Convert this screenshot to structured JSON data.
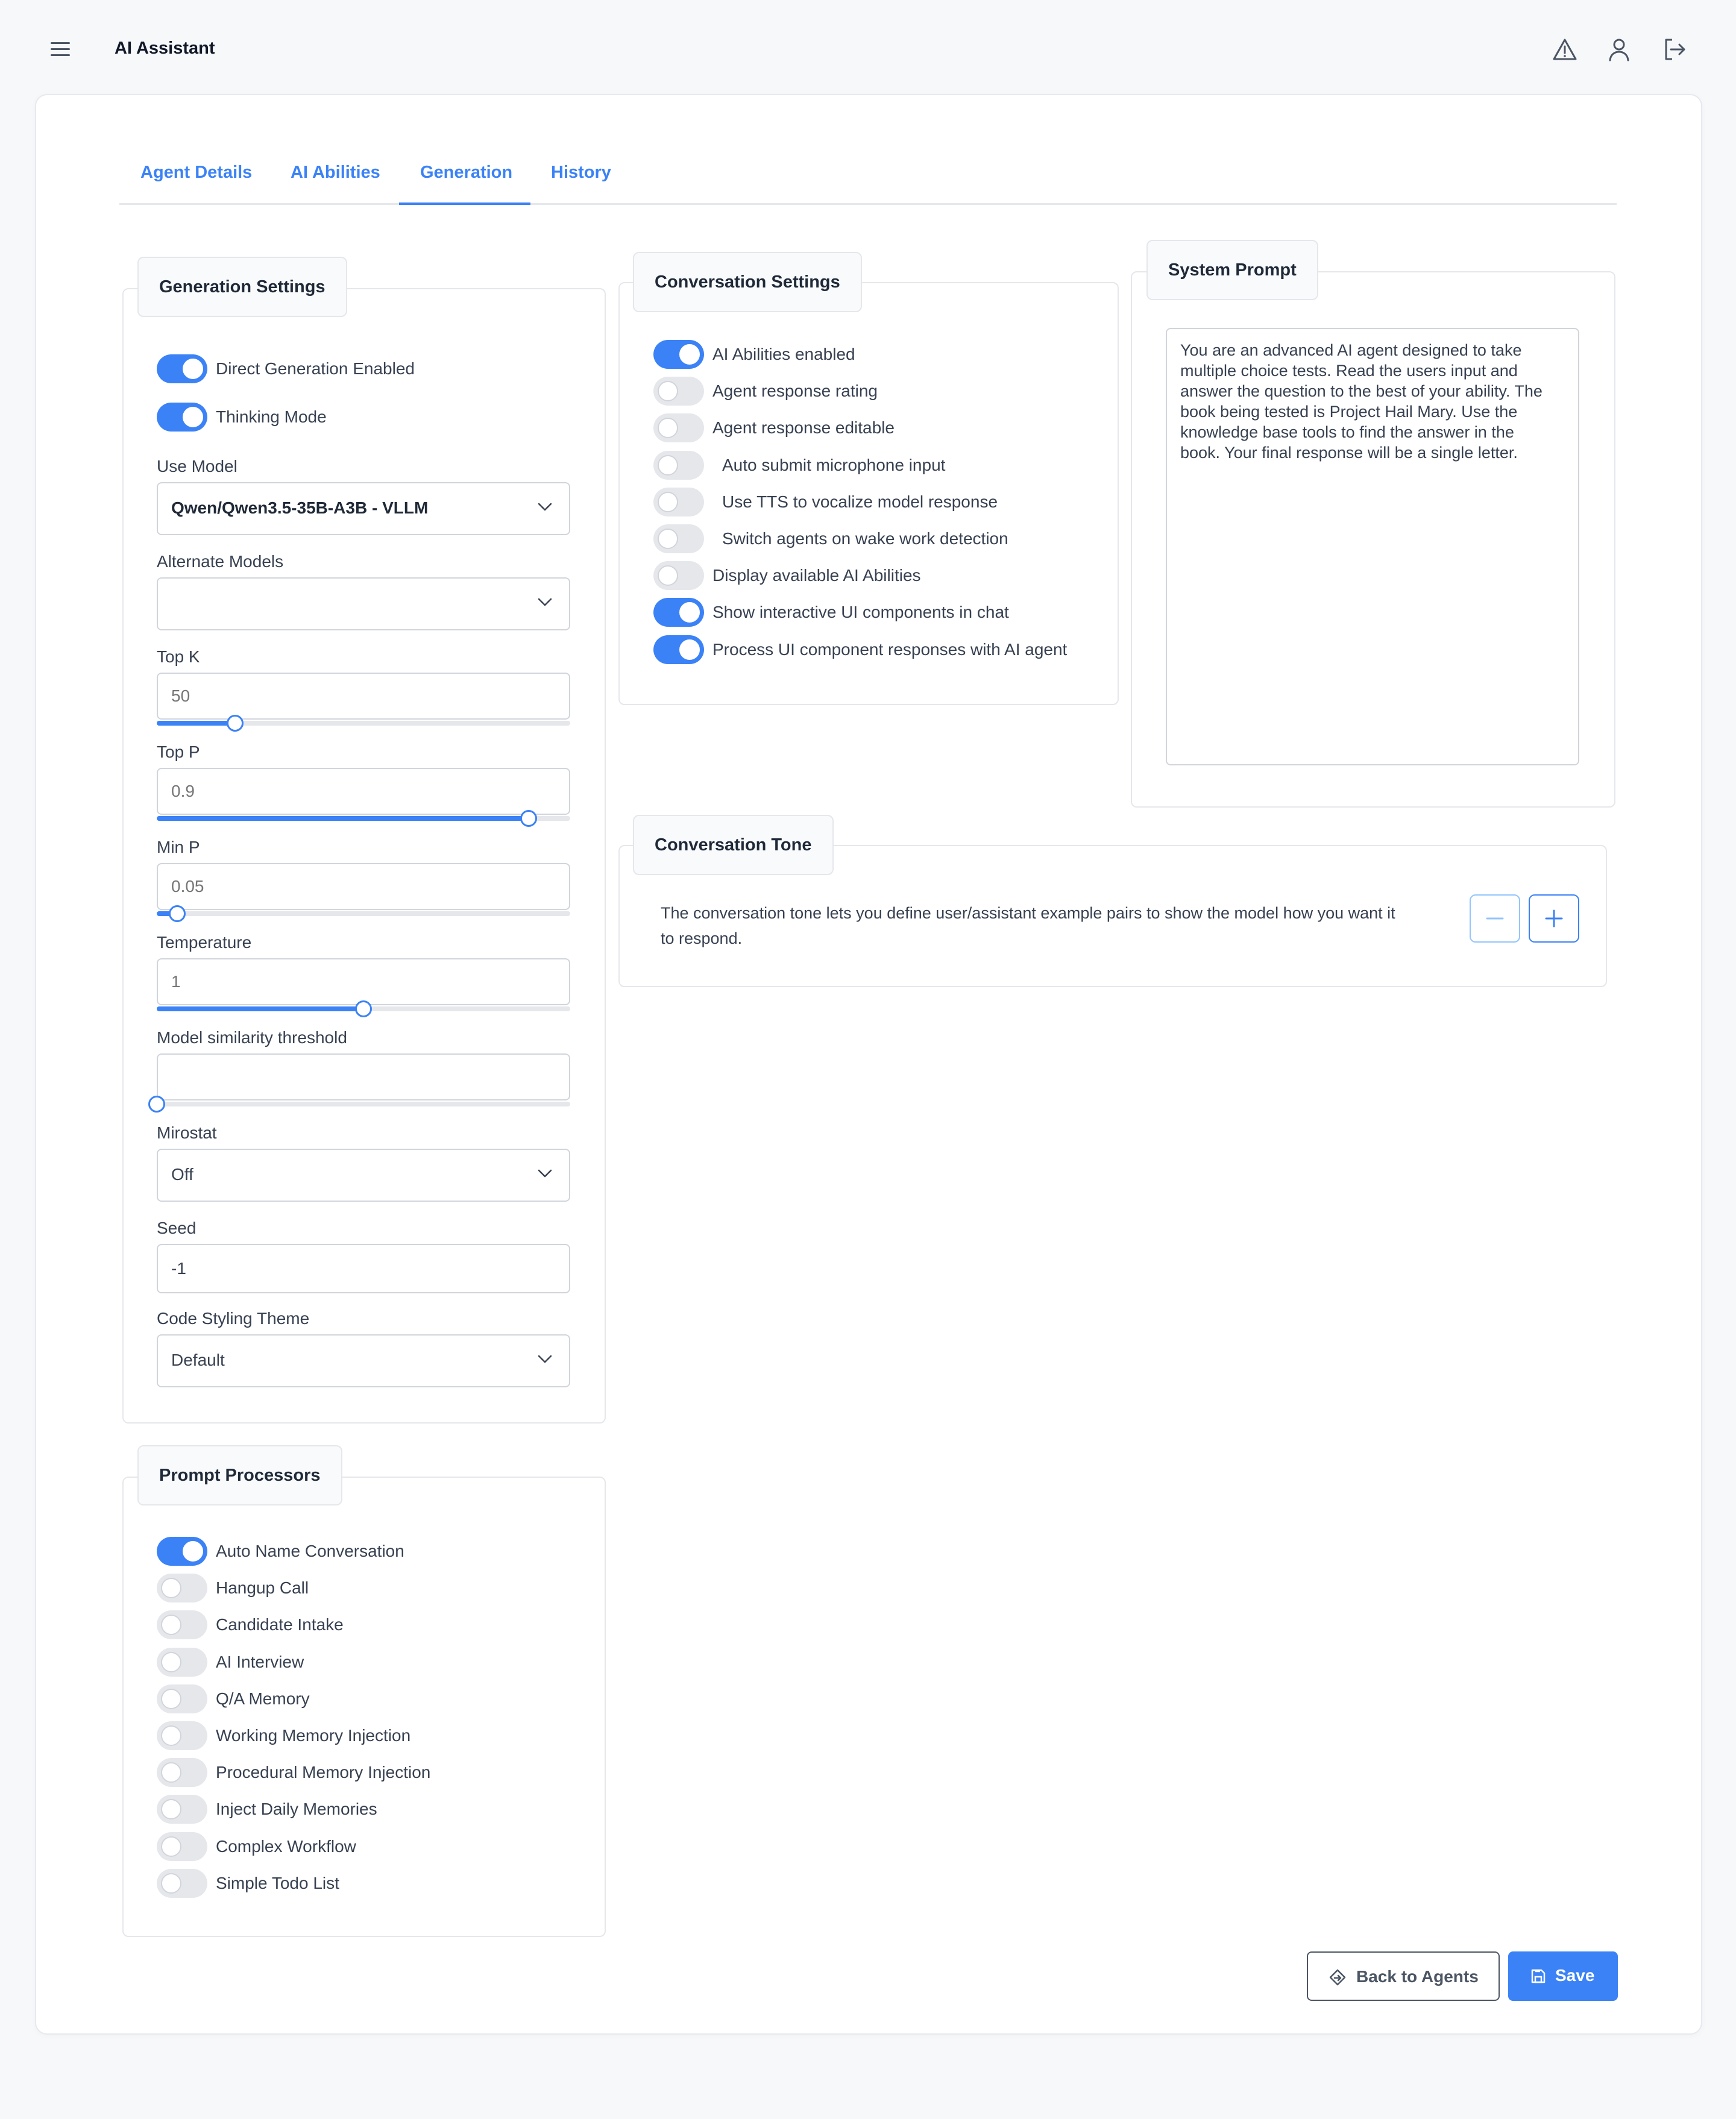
{
  "header": {
    "title": "AI Assistant"
  },
  "tabs": [
    {
      "label": "Agent Details"
    },
    {
      "label": "AI Abilities"
    },
    {
      "label": "Generation"
    },
    {
      "label": "History"
    }
  ],
  "active_tab": "Generation",
  "generation_settings": {
    "title": "Generation Settings",
    "toggles": [
      {
        "label": "Direct Generation Enabled",
        "on": true
      },
      {
        "label": "Thinking Mode",
        "on": true
      }
    ],
    "use_model": {
      "label": "Use Model",
      "value": "Qwen/Qwen3.5-35B-A3B - VLLM"
    },
    "alternate_models": {
      "label": "Alternate Models",
      "value": ""
    },
    "top_k": {
      "label": "Top K",
      "placeholder": "50",
      "fraction": 0.19
    },
    "top_p": {
      "label": "Top P",
      "placeholder": "0.9",
      "fraction": 0.9
    },
    "min_p": {
      "label": "Min P",
      "placeholder": "0.05",
      "fraction": 0.05
    },
    "temperature": {
      "label": "Temperature",
      "placeholder": "1",
      "fraction": 0.5
    },
    "similarity": {
      "label": "Model similarity threshold",
      "placeholder": "",
      "fraction": 0.0
    },
    "mirostat": {
      "label": "Mirostat",
      "value": "Off"
    },
    "seed": {
      "label": "Seed",
      "value": "-1"
    },
    "code_theme": {
      "label": "Code Styling Theme",
      "value": "Default"
    }
  },
  "prompt_processors": {
    "title": "Prompt Processors",
    "toggles": [
      {
        "label": "Auto Name Conversation",
        "on": true
      },
      {
        "label": "Hangup Call",
        "on": false
      },
      {
        "label": "Candidate Intake",
        "on": false
      },
      {
        "label": "AI Interview",
        "on": false
      },
      {
        "label": "Q/A Memory",
        "on": false
      },
      {
        "label": "Working Memory Injection",
        "on": false
      },
      {
        "label": "Procedural Memory Injection",
        "on": false
      },
      {
        "label": "Inject Daily Memories",
        "on": false
      },
      {
        "label": "Complex Workflow",
        "on": false
      },
      {
        "label": "Simple Todo List",
        "on": false
      }
    ]
  },
  "conversation_settings": {
    "title": "Conversation Settings",
    "toggles": [
      {
        "label": "AI Abilities enabled",
        "on": true
      },
      {
        "label": "Agent response rating",
        "on": false
      },
      {
        "label": "Agent response editable",
        "on": false
      },
      {
        "label": "Auto submit microphone input",
        "on": false
      },
      {
        "label": "Use TTS to vocalize model response",
        "on": false
      },
      {
        "label": "Switch agents on wake work detection",
        "on": false
      },
      {
        "label": "Display available AI Abilities",
        "on": false
      },
      {
        "label": "Show interactive UI components in chat",
        "on": true
      },
      {
        "label": "Process UI component responses with AI agent",
        "on": true
      }
    ]
  },
  "system_prompt": {
    "title": "System Prompt",
    "text": "You are an advanced AI agent designed to take\nmultiple choice tests. Read the users input and\nanswer the question to the best of your ability. The\nbook being tested is Project Hail Mary. Use the\nknowledge base tools to find the answer in the\nbook. Your final response will be a single letter."
  },
  "conversation_tone": {
    "title": "Conversation Tone",
    "description_line1": "The conversation tone lets you define user/assistant example pairs to show the model how you want it",
    "description_line2": "to respond."
  },
  "footer": {
    "back_label": "Back to Agents",
    "save_label": "Save"
  },
  "colors": {
    "accent": "#3b82f6",
    "toggle_off": "#e5e7eb",
    "border": "#e5e7eb"
  }
}
